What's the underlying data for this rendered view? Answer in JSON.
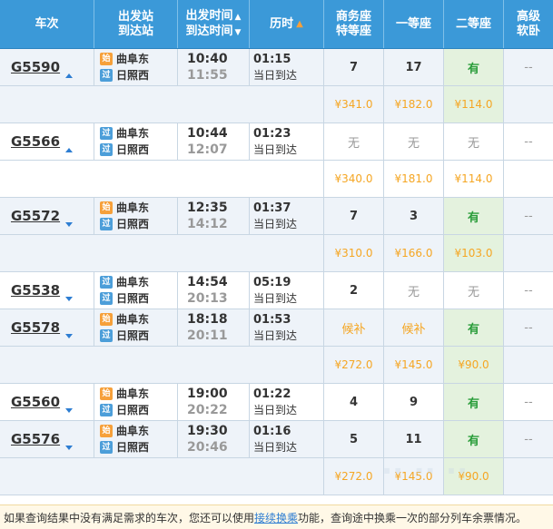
{
  "header": {
    "train": "车次",
    "station_top": "出发站",
    "station_bottom": "到达站",
    "time_top": "出发时间",
    "time_bottom": "到达时间",
    "duration": "历时",
    "business_top": "商务座",
    "business_bottom": "特等座",
    "first": "一等座",
    "second": "二等座",
    "adv_top": "高级",
    "adv_bottom": "软卧"
  },
  "badges": {
    "start": "始",
    "pass": "过"
  },
  "trains": [
    {
      "code": "G5590",
      "from": "曲阜东",
      "to": "日照西",
      "dep": "10:40",
      "arr": "11:55",
      "dur": "01:15",
      "note": "当日到达",
      "business": "7",
      "first": "17",
      "second": "有",
      "adv": "--",
      "p_business": "¥341.0",
      "p_first": "¥182.0",
      "p_second": "¥114.0"
    },
    {
      "code": "G5566",
      "from": "曲阜东",
      "to": "日照西",
      "dep": "10:44",
      "arr": "12:07",
      "dur": "01:23",
      "note": "当日到达",
      "business": "无",
      "first": "无",
      "second": "无",
      "adv": "--",
      "p_business": "¥340.0",
      "p_first": "¥181.0",
      "p_second": "¥114.0"
    },
    {
      "code": "G5572",
      "from": "曲阜东",
      "to": "日照西",
      "dep": "12:35",
      "arr": "14:12",
      "dur": "01:37",
      "note": "当日到达",
      "business": "7",
      "first": "3",
      "second": "有",
      "adv": "--",
      "p_business": "¥310.0",
      "p_first": "¥166.0",
      "p_second": "¥103.0"
    },
    {
      "code": "G5538",
      "from": "曲阜东",
      "to": "日照西",
      "dep": "14:54",
      "arr": "20:13",
      "dur": "05:19",
      "note": "当日到达",
      "business": "2",
      "first": "无",
      "second": "无",
      "adv": "--"
    },
    {
      "code": "G5578",
      "from": "曲阜东",
      "to": "日照西",
      "dep": "18:18",
      "arr": "20:11",
      "dur": "01:53",
      "note": "当日到达",
      "business": "候补",
      "first": "候补",
      "second": "有",
      "adv": "--",
      "p_business": "¥272.0",
      "p_first": "¥145.0",
      "p_second": "¥90.0"
    },
    {
      "code": "G5560",
      "from": "曲阜东",
      "to": "日照西",
      "dep": "19:00",
      "arr": "20:22",
      "dur": "01:22",
      "note": "当日到达",
      "business": "4",
      "first": "9",
      "second": "有",
      "adv": "--"
    },
    {
      "code": "G5576",
      "from": "曲阜东",
      "to": "日照西",
      "dep": "19:30",
      "arr": "20:46",
      "dur": "01:16",
      "note": "当日到达",
      "business": "5",
      "first": "11",
      "second": "有",
      "adv": "--",
      "p_business": "¥272.0",
      "p_first": "¥145.0",
      "p_second": "¥90.0"
    }
  ],
  "footer": {
    "before": "如果查询结果中没有满足需求的车次，您还可以使用",
    "link": "接续换乘",
    "after": " 功能，查询途中换乘一次的部分列车余票情况。"
  },
  "colors": {
    "header_bg": "#3b99d8",
    "price": "#f5a623",
    "available": "#2a9d3a",
    "row_shade": "#eef3f9"
  }
}
